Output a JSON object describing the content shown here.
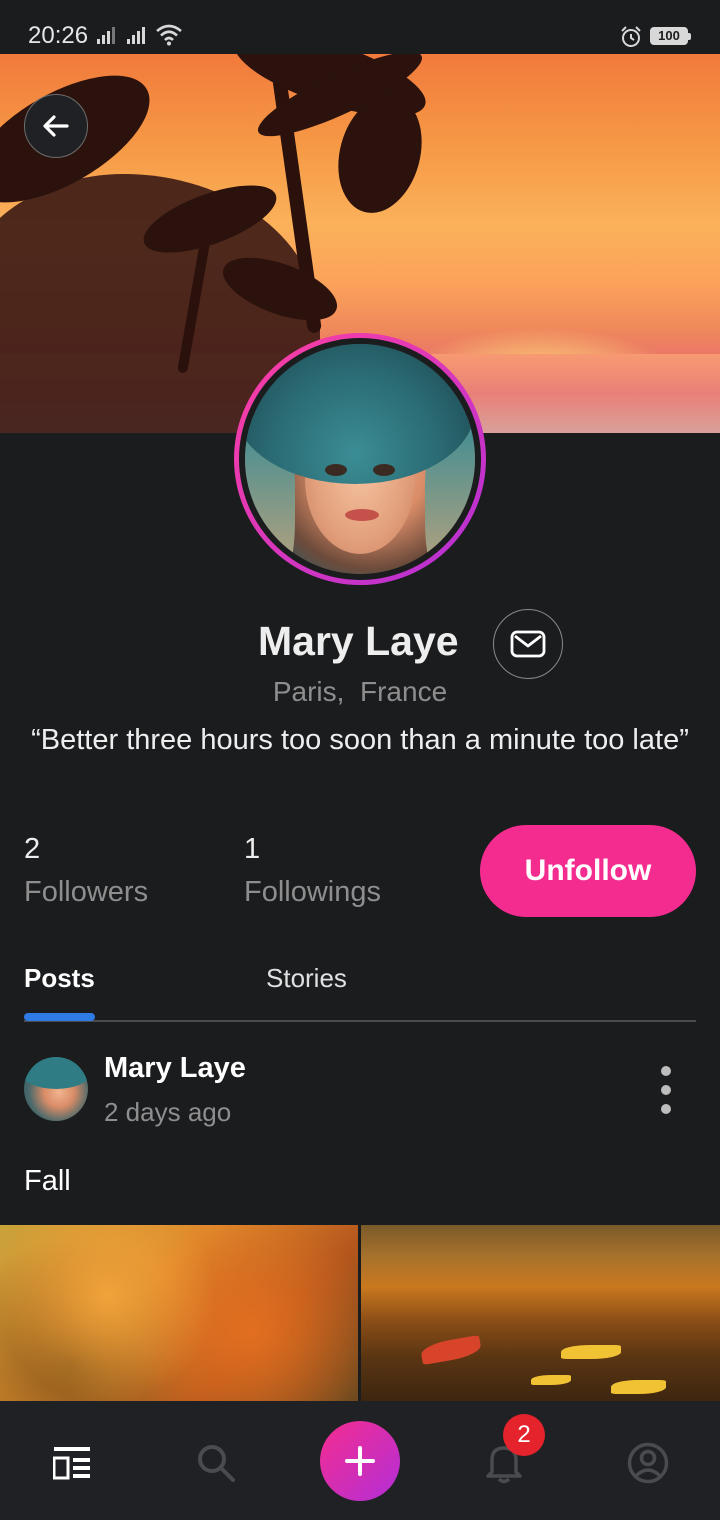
{
  "status_bar": {
    "time": "20:26",
    "battery": "100",
    "icons": [
      "signal-icon",
      "signal-icon",
      "wifi-icon",
      "alarm-icon",
      "battery-icon"
    ]
  },
  "header": {
    "back_icon": "arrow-left-icon"
  },
  "profile": {
    "name": "Mary Laye",
    "location": "Paris,  France",
    "quote": "“Better three hours too soon than a minute too late”",
    "message_icon": "mail-icon",
    "followers_count": "2",
    "followers_label": "Followers",
    "followings_count": "1",
    "followings_label": "Followings",
    "unfollow_label": "Unfollow"
  },
  "tabs": [
    {
      "label": "Posts",
      "active": true
    },
    {
      "label": "Stories",
      "active": false
    }
  ],
  "post": {
    "author": "Mary Laye",
    "time": "2 days ago",
    "text": "Fall",
    "menu_icon": "more-vertical-icon"
  },
  "bottom_nav": {
    "items": [
      "feed-icon",
      "search-icon",
      "add-icon",
      "bell-icon",
      "profile-icon"
    ],
    "notification_count": "2"
  },
  "colors": {
    "background": "#1b1c1e",
    "accent_pink": "#f52c8f",
    "accent_purple": "#b22fd7",
    "tab_indicator": "#2f7be5",
    "badge_red": "#e5232d"
  }
}
